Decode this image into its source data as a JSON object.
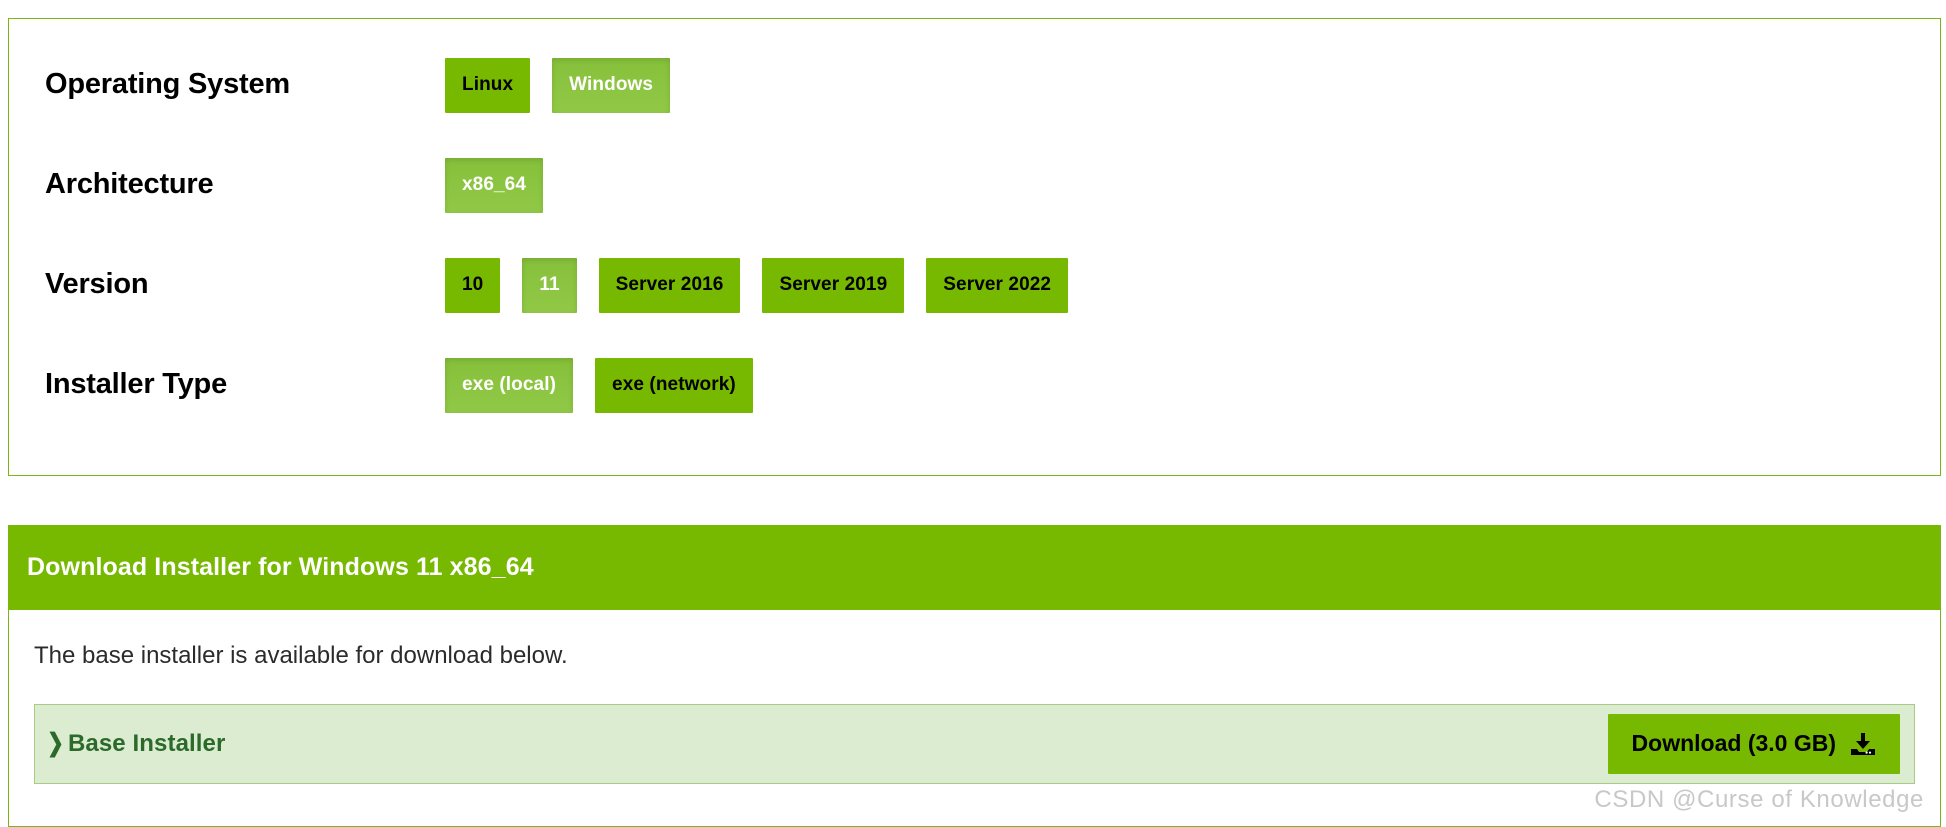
{
  "colors": {
    "nvidia_green": "#76b900",
    "selected_green": "#8cc63f",
    "panel_border": "#7cb518",
    "installer_row_bg": "#dbecd0",
    "installer_text": "#2b6a2b",
    "watermark_gray": "#c8c8c8"
  },
  "selector": {
    "rows": [
      {
        "label": "Operating System",
        "name": "operating-system",
        "options": [
          {
            "label": "Linux",
            "selected": false
          },
          {
            "label": "Windows",
            "selected": true
          }
        ]
      },
      {
        "label": "Architecture",
        "name": "architecture",
        "options": [
          {
            "label": "x86_64",
            "selected": true
          }
        ]
      },
      {
        "label": "Version",
        "name": "version",
        "options": [
          {
            "label": "10",
            "selected": false
          },
          {
            "label": "11",
            "selected": true
          },
          {
            "label": "Server 2016",
            "selected": false
          },
          {
            "label": "Server 2019",
            "selected": false
          },
          {
            "label": "Server 2022",
            "selected": false
          }
        ]
      },
      {
        "label": "Installer Type",
        "name": "installer-type",
        "options": [
          {
            "label": "exe (local)",
            "selected": true
          },
          {
            "label": "exe (network)",
            "selected": false
          }
        ]
      }
    ]
  },
  "download": {
    "header_title": "Download Installer for Windows 11 x86_64",
    "description": "The base installer is available for download below.",
    "installer": {
      "chevron_glyph": "❯",
      "label": "Base Installer",
      "download_label": "Download (3.0 GB)",
      "download_icon_name": "download-tray-icon"
    }
  },
  "watermark": {
    "text": "CSDN @Curse of Knowledge"
  }
}
